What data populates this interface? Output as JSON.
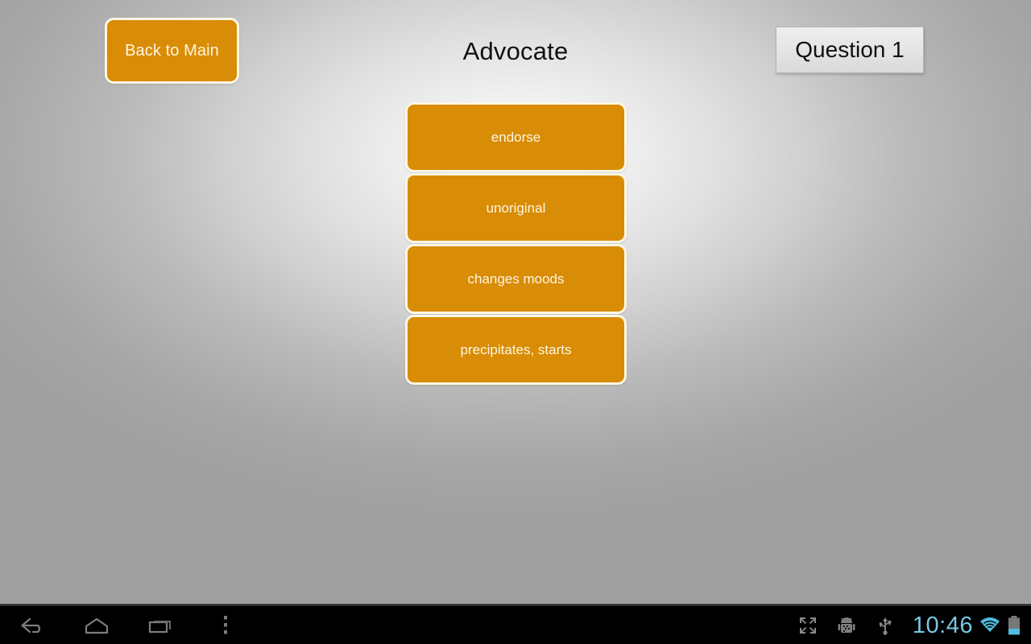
{
  "app": {
    "title": "Advocate",
    "background_center": "#fbfbfb",
    "background_edge": "#9f9f9f",
    "accent_color": "#d98c05",
    "button_border_color": "#fdf6e3"
  },
  "topbar": {
    "back_button": {
      "label": "Back to Main",
      "name": "back-to-main-button"
    },
    "title": "Advocate",
    "question_counter": "Question 1"
  },
  "answers": {
    "options": [
      {
        "label": "endorse"
      },
      {
        "label": "unoriginal"
      },
      {
        "label": "changes moods"
      },
      {
        "label": "precipitates, starts"
      }
    ]
  },
  "system_bar": {
    "nav": [
      {
        "icon": "back-icon",
        "label": "Back"
      },
      {
        "icon": "home-icon",
        "label": "Home"
      },
      {
        "icon": "recents-icon",
        "label": "Recent apps"
      },
      {
        "icon": "overflow-menu-icon",
        "label": "Menu"
      }
    ],
    "status": [
      {
        "icon": "fullscreen-icon",
        "label": "Fullscreen"
      },
      {
        "icon": "android-debug-icon",
        "label": "USB debugging"
      },
      {
        "icon": "usb-icon",
        "label": "USB connected"
      }
    ],
    "clock": "10:46",
    "wifi": {
      "icon": "wifi-icon",
      "label": "Wi-Fi connected"
    },
    "battery": {
      "icon": "battery-icon",
      "label": "Battery low"
    },
    "clock_color": "#79c7e3"
  }
}
